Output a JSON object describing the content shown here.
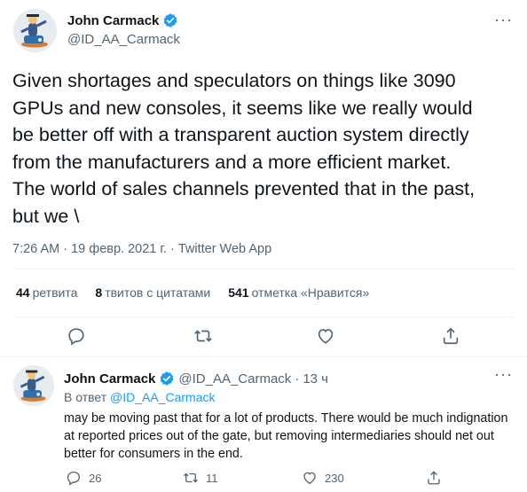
{
  "tweet": {
    "author": {
      "name": "John Carmack",
      "handle": "@ID_AA_Carmack"
    },
    "text": "Given shortages and speculators on things like 3090\nGPUs and new consoles, it seems like we really would\nbe better off with a transparent auction system directly\nfrom the manufacturers and a more efficient market.\nThe world of sales channels prevented that in the past,\nbut we \\",
    "time": "7:26 AM",
    "date": "19 февр. 2021 г.",
    "separator": "·",
    "source": "Twitter Web App",
    "stats": {
      "retweets_count": "44",
      "retweets_label": "ретвита",
      "quotes_count": "8",
      "quotes_label": "твитов с цитатами",
      "likes_count": "541",
      "likes_label": "отметка «Нравится»"
    }
  },
  "reply": {
    "author": {
      "name": "John Carmack",
      "handle": "@ID_AA_Carmack"
    },
    "separator": "·",
    "time_ago": "13 ч",
    "reply_prefix": "В ответ",
    "reply_to": "@ID_AA_Carmack",
    "text": "may be moving past that for a lot of products. There would be much indignation at reported prices out of the gate, but removing intermediaries should net out better for consumers in the end.",
    "counts": {
      "replies": "26",
      "retweets": "11",
      "likes": "230"
    }
  },
  "icons": {
    "verified": "verified-badge-icon",
    "more": "more-icon",
    "reply": "reply-icon",
    "retweet": "retweet-icon",
    "like": "heart-icon",
    "share": "share-icon"
  },
  "colors": {
    "text": "#0f1419",
    "secondary": "#536471",
    "link": "#1d9bf0",
    "divider": "#eff3f4"
  }
}
